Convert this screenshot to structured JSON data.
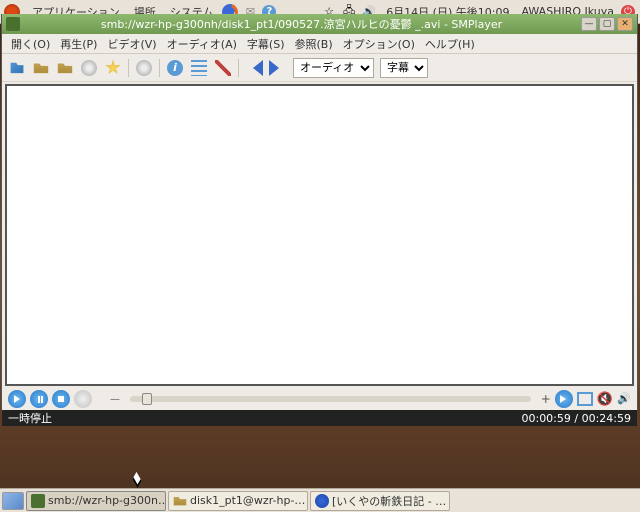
{
  "top_panel": {
    "menus": [
      "アプリケーション",
      "場所",
      "システム"
    ],
    "date": "6月14日 (日) 午後10:09",
    "user": "AWASHIRO Ikuya"
  },
  "window": {
    "title": "smb://wzr-hp-g300nh/disk1_pt1/090527.涼宮ハルヒの憂鬱  _.avi - SMPlayer"
  },
  "menubar": {
    "items": [
      "開く(O)",
      "再生(P)",
      "ビデオ(V)",
      "オーディオ(A)",
      "字幕(S)",
      "参照(B)",
      "オプション(O)",
      "ヘルプ(H)"
    ]
  },
  "toolbar": {
    "audio_label": "オーディオ",
    "subtitle_label": "字幕"
  },
  "status": {
    "state": "一時停止",
    "position": "00:00:59",
    "duration": "00:24:59"
  },
  "taskbar": {
    "items": [
      {
        "label": "smb://wzr-hp-g300n…"
      },
      {
        "label": "disk1_pt1@wzr-hp-…"
      },
      {
        "label": "[いくやの斬鉄日記 - …"
      }
    ]
  }
}
